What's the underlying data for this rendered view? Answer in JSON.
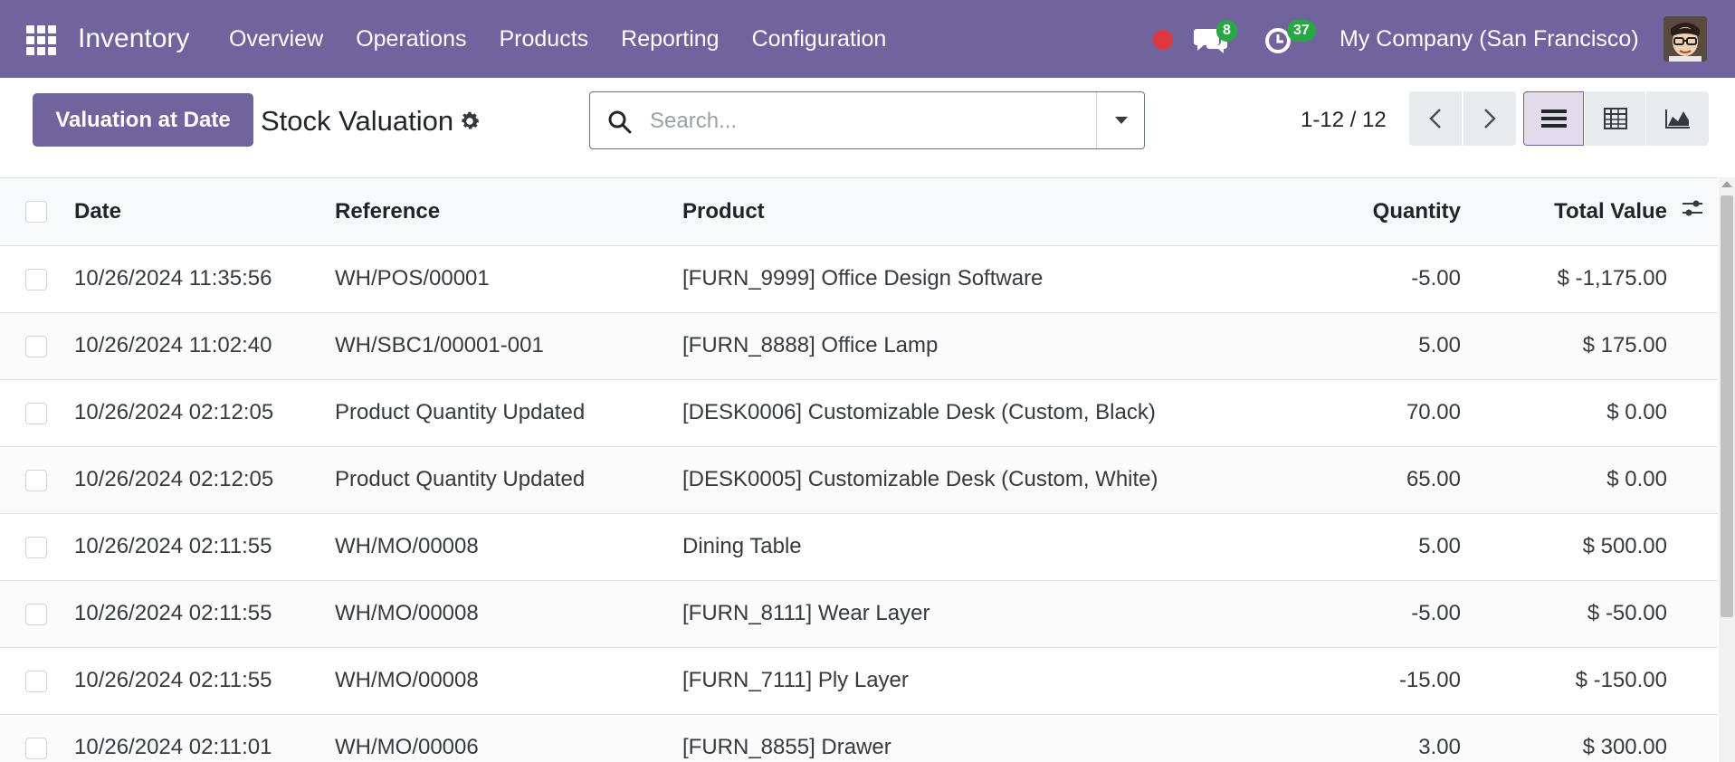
{
  "navbar": {
    "app_title": "Inventory",
    "menu": [
      "Overview",
      "Operations",
      "Products",
      "Reporting",
      "Configuration"
    ],
    "chat_count": "8",
    "activity_count": "37",
    "company": "My Company (San Francisco)",
    "accent_color": "#71639e"
  },
  "control": {
    "primary_button": "Valuation at Date",
    "breadcrumb": "Stock Valuation",
    "search_placeholder": "Search...",
    "pager": "1-12 / 12"
  },
  "table": {
    "headers": {
      "date": "Date",
      "reference": "Reference",
      "product": "Product",
      "quantity": "Quantity",
      "total_value": "Total Value"
    },
    "rows": [
      {
        "date": "10/26/2024 11:35:56",
        "reference": "WH/POS/00001",
        "product": "[FURN_9999] Office Design Software",
        "quantity": "-5.00",
        "total_value": "$ -1,175.00"
      },
      {
        "date": "10/26/2024 11:02:40",
        "reference": "WH/SBC1/00001-001",
        "product": "[FURN_8888] Office Lamp",
        "quantity": "5.00",
        "total_value": "$ 175.00"
      },
      {
        "date": "10/26/2024 02:12:05",
        "reference": "Product Quantity Updated",
        "product": "[DESK0006] Customizable Desk (Custom, Black)",
        "quantity": "70.00",
        "total_value": "$ 0.00"
      },
      {
        "date": "10/26/2024 02:12:05",
        "reference": "Product Quantity Updated",
        "product": "[DESK0005] Customizable Desk (Custom, White)",
        "quantity": "65.00",
        "total_value": "$ 0.00"
      },
      {
        "date": "10/26/2024 02:11:55",
        "reference": "WH/MO/00008",
        "product": "Dining Table",
        "quantity": "5.00",
        "total_value": "$ 500.00"
      },
      {
        "date": "10/26/2024 02:11:55",
        "reference": "WH/MO/00008",
        "product": "[FURN_8111] Wear Layer",
        "quantity": "-5.00",
        "total_value": "$ -50.00"
      },
      {
        "date": "10/26/2024 02:11:55",
        "reference": "WH/MO/00008",
        "product": "[FURN_7111] Ply Layer",
        "quantity": "-15.00",
        "total_value": "$ -150.00"
      },
      {
        "date": "10/26/2024 02:11:01",
        "reference": "WH/MO/00006",
        "product": "[FURN_8855] Drawer",
        "quantity": "3.00",
        "total_value": "$ 300.00"
      }
    ]
  }
}
